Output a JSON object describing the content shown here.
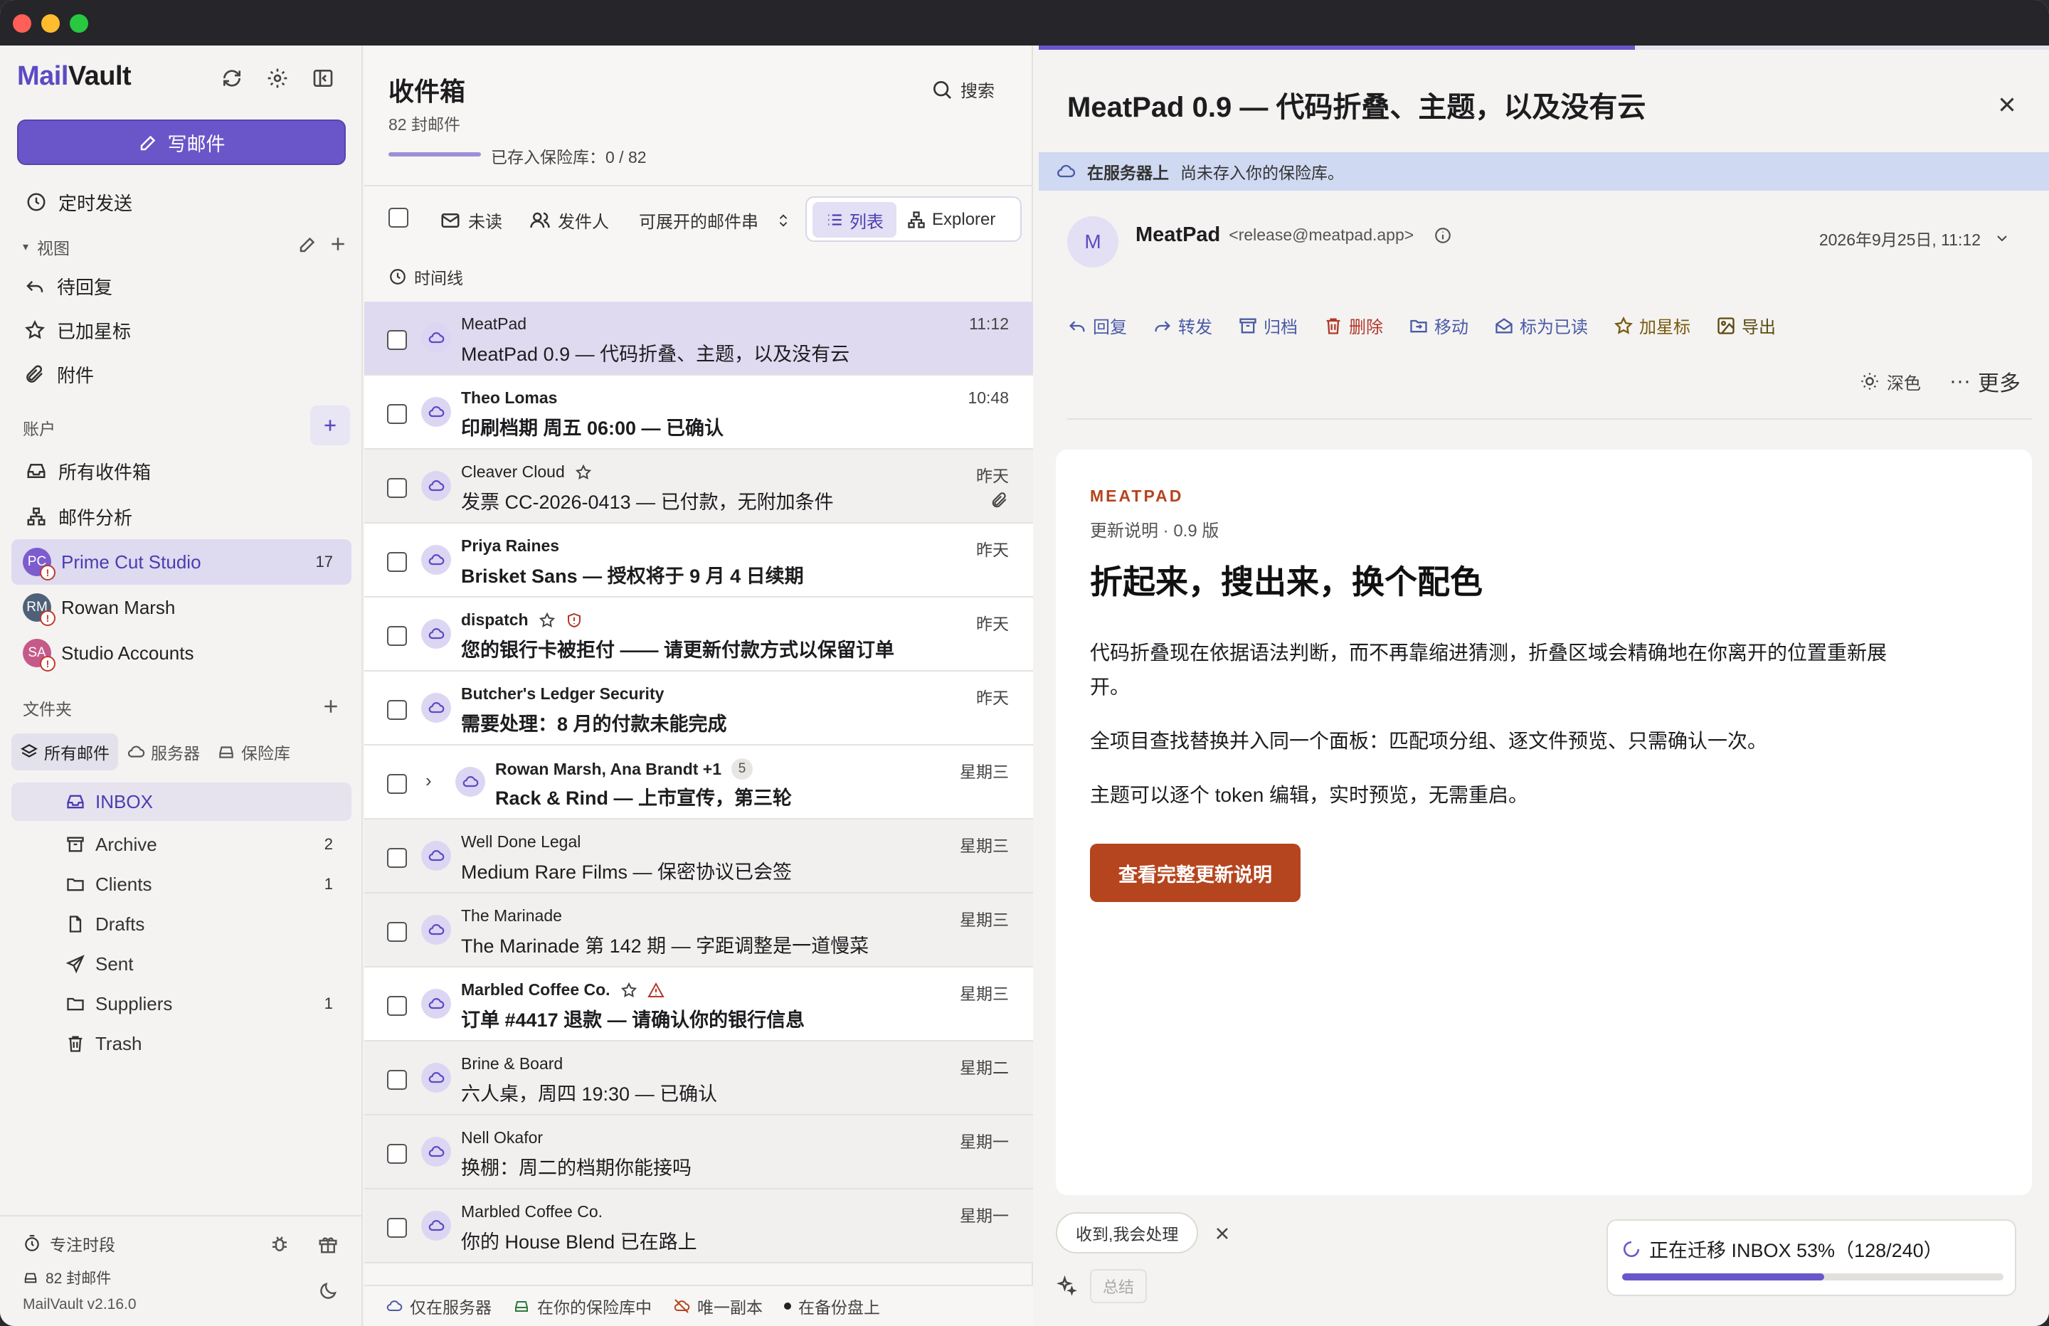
{
  "sidebar": {
    "brand_mail": "Mail",
    "brand_vault": "Vault",
    "compose": "写邮件",
    "scheduled": "定时发送",
    "views_label": "视图",
    "views": [
      "待回复",
      "已加星标",
      "附件"
    ],
    "accounts_label": "账户",
    "all_inboxes": "所有收件箱",
    "analytics": "邮件分析",
    "accounts": [
      {
        "initials": "PC",
        "name": "Prime Cut Studio",
        "count": "17",
        "color": "#7c5ccf"
      },
      {
        "initials": "RM",
        "name": "Rowan Marsh",
        "count": "",
        "color": "#4f6178"
      },
      {
        "initials": "SA",
        "name": "Studio Accounts",
        "count": "",
        "color": "#c55a8a"
      }
    ],
    "folders_label": "文件夹",
    "seg": [
      "所有邮件",
      "服务器",
      "保险库"
    ],
    "folders": [
      {
        "name": "INBOX",
        "count": "",
        "icon": "inbox-icon"
      },
      {
        "name": "Archive",
        "count": "2",
        "icon": "archive-icon"
      },
      {
        "name": "Clients",
        "count": "1",
        "icon": "folder-icon"
      },
      {
        "name": "Drafts",
        "count": "",
        "icon": "file-icon"
      },
      {
        "name": "Sent",
        "count": "",
        "icon": "send-icon"
      },
      {
        "name": "Suppliers",
        "count": "1",
        "icon": "folder-icon"
      },
      {
        "name": "Trash",
        "count": "",
        "icon": "trash-icon"
      }
    ],
    "focus": "专注时段",
    "mail_count": "82 封邮件",
    "version": "MailVault v2.16.0"
  },
  "list": {
    "title": "收件箱",
    "count": "82 封邮件",
    "search": "搜索",
    "vault_status": "已存入保险库：0 / 82",
    "filters": {
      "unread": "未读",
      "sender": "发件人",
      "threads": "可展开的邮件串",
      "list": "列表",
      "explorer": "Explorer",
      "timeline": "时间线"
    },
    "mails": [
      {
        "from": "MeatPad",
        "subject": "MeatPad 0.9 — 代码折叠、主题，以及没有云",
        "time": "11:12",
        "unread": false
      },
      {
        "from": "Theo Lomas",
        "subject": "印刷档期 周五 06:00 — 已确认",
        "time": "10:48",
        "unread": true
      },
      {
        "from": "Cleaver Cloud",
        "subject": "发票 CC-2026-0413 — 已付款，无附加条件",
        "time": "昨天",
        "unread": false
      },
      {
        "from": "Priya Raines",
        "subject": "Brisket Sans — 授权将于 9 月 4 日续期",
        "time": "昨天",
        "unread": true
      },
      {
        "from": "dispatch",
        "subject": "您的银行卡被拒付 —— 请更新付款方式以保留订单",
        "time": "昨天",
        "unread": true
      },
      {
        "from": "Butcher's Ledger Security",
        "subject": "需要处理：8 月的付款未能完成",
        "time": "昨天",
        "unread": true
      },
      {
        "from": "Rowan Marsh, Ana Brandt +1",
        "thread_count": "5",
        "subject": "Rack & Rind — 上市宣传，第三轮",
        "time": "星期三",
        "unread": true
      },
      {
        "from": "Well Done Legal",
        "subject": "Medium Rare Films — 保密协议已会签",
        "time": "星期三",
        "unread": false
      },
      {
        "from": "The Marinade",
        "subject": "The Marinade 第 142 期 — 字距调整是一道慢菜",
        "time": "星期三",
        "unread": false
      },
      {
        "from": "Marbled Coffee Co.",
        "subject": "订单 #4417 退款 — 请确认你的银行信息",
        "time": "星期三",
        "unread": true
      },
      {
        "from": "Brine & Board",
        "subject": "六人桌，周四 19:30 — 已确认",
        "time": "星期二",
        "unread": false
      },
      {
        "from": "Nell Okafor",
        "subject": "换棚：周二的档期你能接吗",
        "time": "星期一",
        "unread": false
      },
      {
        "from": "Marbled Coffee Co.",
        "subject": "你的 House Blend 已在路上",
        "time": "星期一",
        "unread": false
      }
    ],
    "legend": [
      "仅在服务器",
      "在你的保险库中",
      "唯一副本",
      "在备份盘上"
    ]
  },
  "reader": {
    "top_progress": 0.59,
    "title": "MeatPad 0.9 — 代码折叠、主题，以及没有云",
    "server_label": "在服务器上",
    "server_note": "尚未存入你的保险库。",
    "sender_initial": "M",
    "sender_name": "MeatPad",
    "sender_addr": "<release@meatpad.app>",
    "date": "2026年9月25日, 11:12",
    "actions": {
      "reply": "回复",
      "forward": "转发",
      "archive": "归档",
      "delete": "删除",
      "move": "移动",
      "mark_read": "标为已读",
      "star": "加星标",
      "export": "导出",
      "dark": "深色",
      "more": "更多"
    },
    "body": {
      "brand": "MEATPAD",
      "sub": "更新说明 · 0.9 版",
      "headline": "折起来，搜出来，换个配色",
      "p1": "代码折叠现在依据语法判断，而不再靠缩进猜测，折叠区域会精确地在你离开的位置重新展开。",
      "p2": "全项目查找替换并入同一个面板：匹配项分组、逐文件预览、只需确认一次。",
      "p3": "主题可以逐个 token 编辑，实时预览，无需重启。",
      "cta": "查看完整更新说明"
    },
    "quick_reply": "收到,我会处理",
    "summary": "总结",
    "migrate": {
      "text": "正在迁移 INBOX 53%（128/240）",
      "progress": 0.53
    }
  },
  "colors": {
    "accent": "#6a56c9",
    "brand_orange": "#b5451f",
    "server_bar": "#cfd9f2"
  }
}
